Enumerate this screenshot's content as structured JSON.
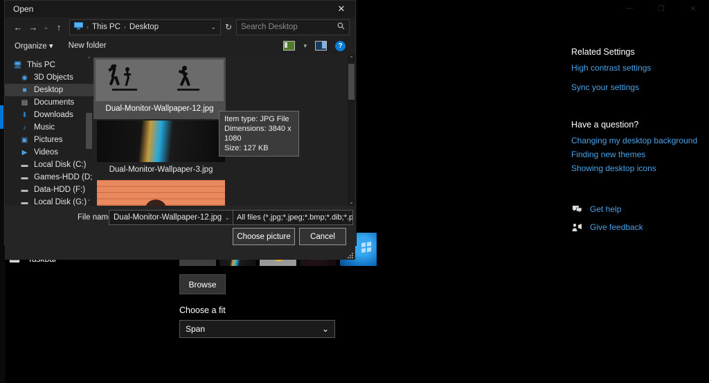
{
  "settings": {
    "window_controls": {
      "minimize": "—",
      "maximize": "❐",
      "close": "✕"
    },
    "nav": {
      "taskbar_label": "Taskbar",
      "taskbar_icon": "taskbar-icon"
    },
    "background": {
      "browse_label": "Browse",
      "choose_fit_label": "Choose a fit",
      "fit_value": "Span",
      "fit_chevron": "⌄",
      "thumbnails": [
        {
          "name": "recent-image-1"
        },
        {
          "name": "recent-image-2"
        },
        {
          "name": "recent-image-3"
        },
        {
          "name": "recent-image-4"
        },
        {
          "name": "recent-image-5"
        }
      ]
    },
    "related": {
      "title": "Related Settings",
      "links": [
        {
          "label": "High contrast settings"
        },
        {
          "label": "Sync your settings"
        }
      ]
    },
    "question": {
      "title": "Have a question?",
      "links": [
        {
          "label": "Changing my desktop background"
        },
        {
          "label": "Finding new themes"
        },
        {
          "label": "Showing desktop icons"
        }
      ]
    },
    "help": [
      {
        "label": "Get help",
        "icon": "chat-bubble-icon",
        "glyph": "✉"
      },
      {
        "label": "Give feedback",
        "icon": "feedback-person-icon",
        "glyph": "⚑"
      }
    ]
  },
  "dialog": {
    "title": "Open",
    "close_glyph": "✕",
    "nav": {
      "back": "←",
      "forward": "→",
      "history": "⌄",
      "up": "↑",
      "refresh": "↻",
      "breadcrumb": [
        "This PC",
        "Desktop"
      ],
      "breadcrumb_sep": "›",
      "address_chevron": "⌄",
      "drive_icon": "computer-icon"
    },
    "search": {
      "placeholder": "Search Desktop",
      "icon_glyph": "⚲"
    },
    "toolbar": {
      "organize_label": "Organize",
      "organize_chevron": "▾",
      "new_folder_label": "New folder",
      "view_chevron": "▾",
      "help_glyph": "?"
    },
    "tree": [
      {
        "label": "This PC",
        "icon": "computer-icon",
        "glyph": "🖥",
        "root": true,
        "selected": false
      },
      {
        "label": "3D Objects",
        "icon": "3d-objects-icon",
        "glyph": "◉",
        "root": false,
        "selected": false
      },
      {
        "label": "Desktop",
        "icon": "desktop-icon",
        "glyph": "■",
        "root": false,
        "selected": true
      },
      {
        "label": "Documents",
        "icon": "documents-icon",
        "glyph": "▤",
        "root": false,
        "selected": false
      },
      {
        "label": "Downloads",
        "icon": "downloads-icon",
        "glyph": "⬇",
        "root": false,
        "selected": false
      },
      {
        "label": "Music",
        "icon": "music-icon",
        "glyph": "♪",
        "root": false,
        "selected": false
      },
      {
        "label": "Pictures",
        "icon": "pictures-icon",
        "glyph": "▣",
        "root": false,
        "selected": false
      },
      {
        "label": "Videos",
        "icon": "videos-icon",
        "glyph": "▶",
        "root": false,
        "selected": false
      },
      {
        "label": "Local Disk (C:)",
        "icon": "drive-icon",
        "glyph": "▬",
        "root": false,
        "selected": false
      },
      {
        "label": "Games-HDD (D;",
        "icon": "drive-icon",
        "glyph": "▬",
        "root": false,
        "selected": false
      },
      {
        "label": "Data-HDD (F:)",
        "icon": "drive-icon",
        "glyph": "▬",
        "root": false,
        "selected": false
      },
      {
        "label": "Local Disk (G:)",
        "icon": "drive-icon",
        "glyph": "▬",
        "root": false,
        "selected": false
      }
    ],
    "tree_scroll": {
      "up": "⌃",
      "down": "⌄"
    },
    "files": [
      {
        "label": "Dual-Monitor-Wallpaper-12.jpg",
        "selected": true
      },
      {
        "label": "Dual-Monitor-Wallpaper-3.jpg",
        "selected": false
      },
      {
        "label": "",
        "selected": false
      }
    ],
    "file_scroll": {
      "up": "⌃",
      "down": "⌄"
    },
    "tooltip": {
      "item_type": "Item type: JPG File",
      "dimensions": "Dimensions: 3840 x 1080",
      "size": "Size: 127 KB"
    },
    "footer": {
      "file_name_label": "File name:",
      "file_name_value": "Dual-Monitor-Wallpaper-12.jpg",
      "file_name_chevron": "⌄",
      "filter_value": "All files (*.jpg;*.jpeg;*.bmp;*.dib;*.png",
      "filter_chevron": "⌄",
      "choose_picture_label": "Choose picture",
      "cancel_label": "Cancel"
    }
  },
  "colors": {
    "accent": "#0078d7",
    "link": "#4aa3e8",
    "selection": "#4d4d4d"
  }
}
